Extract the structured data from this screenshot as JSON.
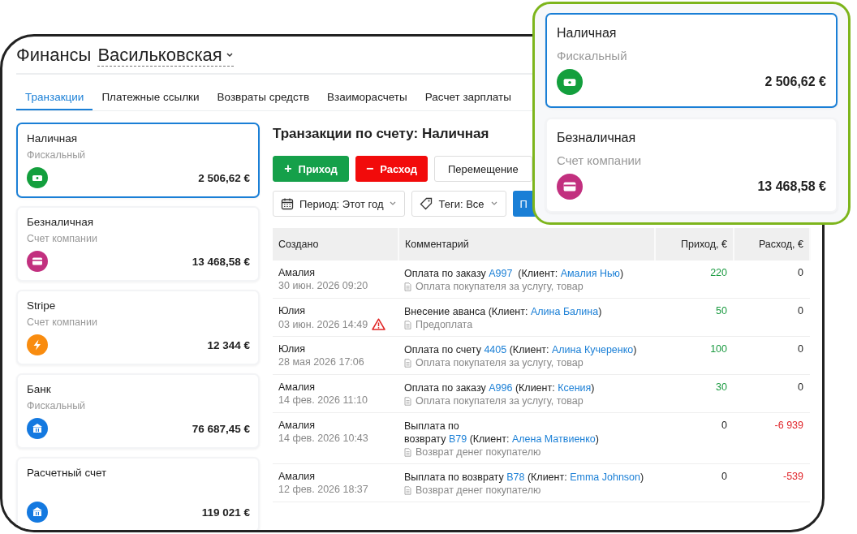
{
  "header": {
    "title": "Финансы",
    "location": "Васильковская"
  },
  "tabs": [
    {
      "label": "Транзакции",
      "selected": true
    },
    {
      "label": "Платежные ссылки",
      "selected": false
    },
    {
      "label": "Возвраты средств",
      "selected": false
    },
    {
      "label": "Взаиморасчеты",
      "selected": false
    },
    {
      "label": "Расчет зарплаты",
      "selected": false
    }
  ],
  "accounts": [
    {
      "name": "Наличная",
      "type": "Фискальный",
      "amount": "2 506,62 €",
      "kind": "cash",
      "color": "#139f3d",
      "selected": true
    },
    {
      "name": "Безналичная",
      "type": "Счет компании",
      "amount": "13 468,58 €",
      "kind": "card",
      "color": "#c2307f",
      "selected": false
    },
    {
      "name": "Stripe",
      "type": "Счет компании",
      "amount": "12 344 €",
      "kind": "bolt",
      "color": "#f98c0f",
      "selected": false
    },
    {
      "name": "Банк",
      "type": "Фискальный",
      "amount": "76 687,45 €",
      "kind": "bank",
      "color": "#1479e0",
      "selected": false
    },
    {
      "name": "Расчетный счет",
      "amount": "119 021 €",
      "kind": "bank",
      "color": "#1479e0",
      "selected": false
    }
  ],
  "content": {
    "title": "Транзакции по счету: Наличная",
    "actions": [
      {
        "label": "Приход",
        "kind": "income",
        "symbol": "+"
      },
      {
        "label": "Расход",
        "kind": "expense",
        "symbol": "−"
      },
      {
        "label": "Перемещение",
        "kind": "plain"
      }
    ],
    "filters": [
      {
        "label": "Период: Этот год",
        "kind": "calendar"
      },
      {
        "label": "Теги: Все",
        "kind": "tag"
      }
    ],
    "apply_button": "П",
    "table": {
      "columns": [
        "Создано",
        "Комментарий",
        "Приход, €",
        "Расход, €"
      ],
      "rows": [
        {
          "author": "Амалия",
          "date": "30 июн. 2026 09:20",
          "warning": false,
          "comment": [
            [
              {
                "text": "Оплата по заказу ",
                "link": false
              },
              {
                "text": "A997",
                "link": true
              },
              {
                "text": "  (Клиент: ",
                "link": false
              },
              {
                "text": "Амалия Нью",
                "link": true
              },
              {
                "text": ")",
                "link": false
              }
            ]
          ],
          "note": "Оплата покупателя за услугу, товар",
          "income": {
            "text": "220",
            "kind": "positive"
          },
          "expense": {
            "text": "0",
            "kind": "neutral"
          }
        },
        {
          "author": "Юлия",
          "date": "03 июн. 2026 14:49",
          "warning": true,
          "comment": [
            [
              {
                "text": "Внесение аванса (Клиент: ",
                "link": false
              },
              {
                "text": "Алина Балина",
                "link": true
              },
              {
                "text": ")",
                "link": false
              }
            ]
          ],
          "note": "Предоплата",
          "income": {
            "text": "50",
            "kind": "positive"
          },
          "expense": {
            "text": "0",
            "kind": "neutral"
          }
        },
        {
          "author": "Юлия",
          "date": "28 мая 2026 17:06",
          "warning": false,
          "comment": [
            [
              {
                "text": "Оплата по счету ",
                "link": false
              },
              {
                "text": "4405",
                "link": true
              },
              {
                "text": " (Клиент: ",
                "link": false
              },
              {
                "text": "Алина Кучеренко",
                "link": true
              },
              {
                "text": ")",
                "link": false
              }
            ]
          ],
          "note": "Оплата покупателя за услугу, товар",
          "income": {
            "text": "100",
            "kind": "positive"
          },
          "expense": {
            "text": "0",
            "kind": "neutral"
          }
        },
        {
          "author": "Амалия",
          "date": "14 фев. 2026 11:10",
          "warning": false,
          "comment": [
            [
              {
                "text": "Оплата по заказу ",
                "link": false
              },
              {
                "text": "A996",
                "link": true
              },
              {
                "text": " (Клиент: ",
                "link": false
              },
              {
                "text": "Ксения",
                "link": true
              },
              {
                "text": ")",
                "link": false
              }
            ]
          ],
          "note": "Оплата покупателя за услугу, товар",
          "income": {
            "text": "30",
            "kind": "positive"
          },
          "expense": {
            "text": "0",
            "kind": "neutral"
          }
        },
        {
          "author": "Амалия",
          "date": "14 фев. 2026 10:43",
          "warning": false,
          "comment": [
            [
              {
                "text": "Выплата по",
                "link": false
              }
            ],
            [
              {
                "text": "возврату ",
                "link": false
              },
              {
                "text": "B79",
                "link": true
              },
              {
                "text": " (Клиент: ",
                "link": false
              },
              {
                "text": "Алена Матвиенко",
                "link": true
              },
              {
                "text": ")",
                "link": false
              }
            ]
          ],
          "note": "Возврат денег покупателю",
          "income": {
            "text": "0",
            "kind": "neutral"
          },
          "expense": {
            "text": "-6 939",
            "kind": "negative"
          }
        },
        {
          "author": "Амалия",
          "date": "12 фев. 2026 18:37",
          "warning": false,
          "comment": [
            [
              {
                "text": "Выплата по возврату ",
                "link": false
              },
              {
                "text": "B78",
                "link": true
              },
              {
                "text": " (Клиент: ",
                "link": false
              },
              {
                "text": "Emma Johnson",
                "link": true
              },
              {
                "text": ")",
                "link": false
              }
            ]
          ],
          "note": "Возврат денег покупателю",
          "income": {
            "text": "0",
            "kind": "neutral"
          },
          "expense": {
            "text": "-539",
            "kind": "negative"
          }
        }
      ]
    }
  },
  "callout": {
    "accounts": [
      {
        "name": "Наличная",
        "type": "Фискальный",
        "amount": "2 506,62 €",
        "kind": "cash",
        "color": "#139f3d",
        "selected": true
      },
      {
        "name": "Безналичная",
        "type": "Счет компании",
        "amount": "13 468,58 €",
        "kind": "card",
        "color": "#c2307f",
        "selected": false
      }
    ]
  }
}
